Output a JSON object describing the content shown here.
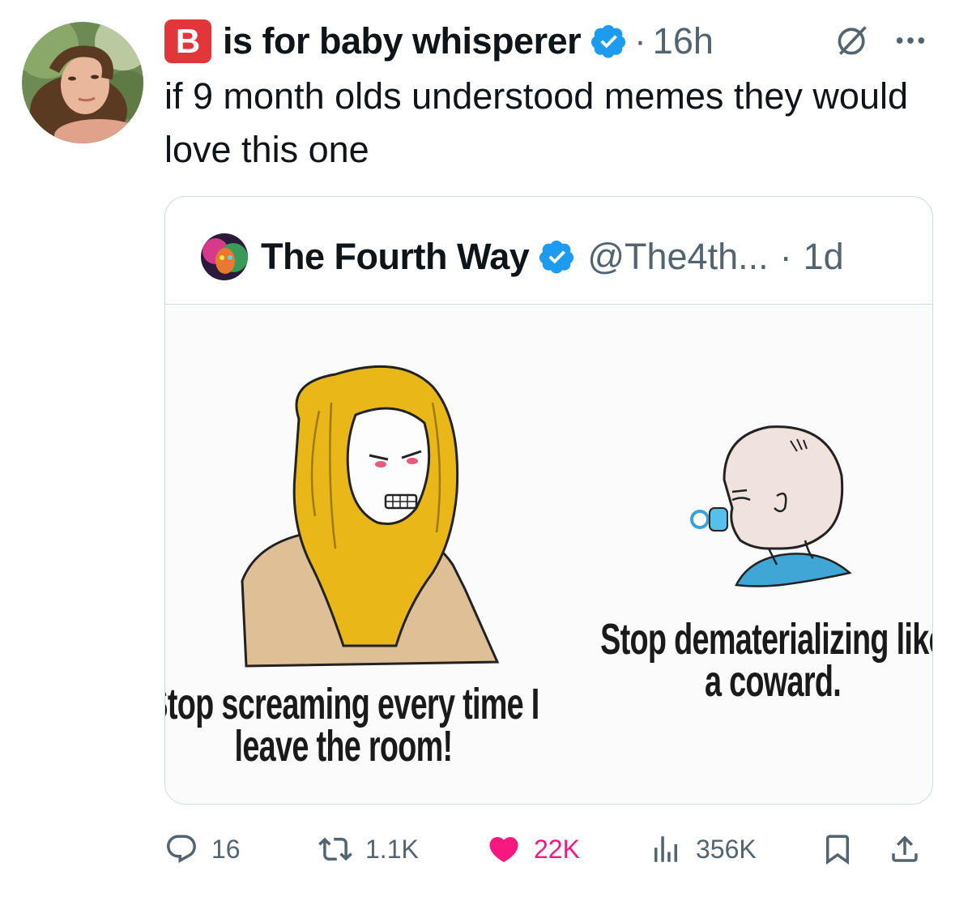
{
  "tweet": {
    "author": {
      "display_name": "is for baby whisperer",
      "name_emoji": "B",
      "verified": true,
      "time": "16h",
      "avatar_icon": "profile-photo"
    },
    "text": "if 9 month olds understood memes they would love this one"
  },
  "quote": {
    "display_name": "The Fourth Way",
    "handle": "@The4th...",
    "time": "1d",
    "verified": true,
    "meme": {
      "caption_left": "Stop screaming every time I leave the room!",
      "caption_right": "Stop dematerializing like a coward."
    }
  },
  "actions": {
    "replies": "16",
    "reposts": "1.1K",
    "likes": "22K",
    "views": "356K"
  },
  "colors": {
    "verified": "#1d9bf0",
    "like": "#f91880",
    "muted": "#536471",
    "emoji_bg": "#e1373a"
  }
}
